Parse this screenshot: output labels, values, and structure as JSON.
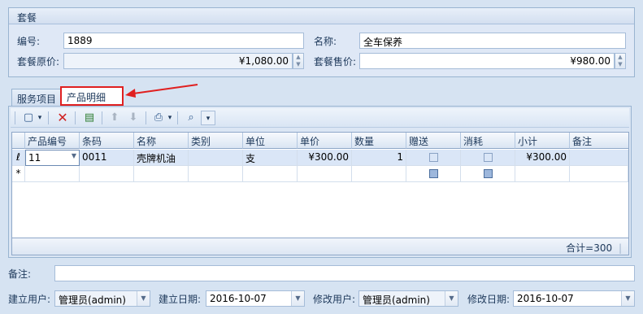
{
  "group": {
    "title": "套餐",
    "code_label": "编号:",
    "code_value": "1889",
    "name_label": "名称:",
    "name_value": "全车保养",
    "orig_price_label": "套餐原价:",
    "orig_price_value": "¥1,080.00",
    "sale_price_label": "套餐售价:",
    "sale_price_value": "¥980.00"
  },
  "tabs": [
    {
      "label": "服务项目"
    },
    {
      "label": "产品明细"
    }
  ],
  "toolbar": {
    "new_icon": "▢",
    "delete_icon": "✕",
    "save_icon": "▤",
    "up_icon": "⬆",
    "down_icon": "⬇",
    "print_icon": "⎙",
    "preview_icon": "⌕",
    "dropdown_icon": "▾"
  },
  "grid": {
    "columns": [
      "产品编号",
      "条码",
      "名称",
      "类别",
      "单位",
      "单价",
      "数量",
      "赠送",
      "消耗",
      "小计",
      "备注"
    ],
    "row": {
      "marker": "ℓ",
      "product_code": "11",
      "barcode": "0011",
      "name": "壳牌机油",
      "category": "",
      "unit": "支",
      "price": "¥300.00",
      "qty": "1",
      "subtotal": "¥300.00",
      "remark": ""
    },
    "new_row_marker": "*",
    "total": "合计=300"
  },
  "bottom": {
    "remark_label": "备注:",
    "remark_value": "",
    "created_by_label": "建立用户:",
    "created_by_value": "管理员(admin)",
    "created_date_label": "建立日期:",
    "created_date_value": "2016-10-07",
    "modified_by_label": "修改用户:",
    "modified_by_value": "管理员(admin)",
    "modified_date_label": "修改日期:",
    "modified_date_value": "2016-10-07"
  },
  "colors": {
    "highlight": "#e02020",
    "background": "#d6e3f2"
  }
}
